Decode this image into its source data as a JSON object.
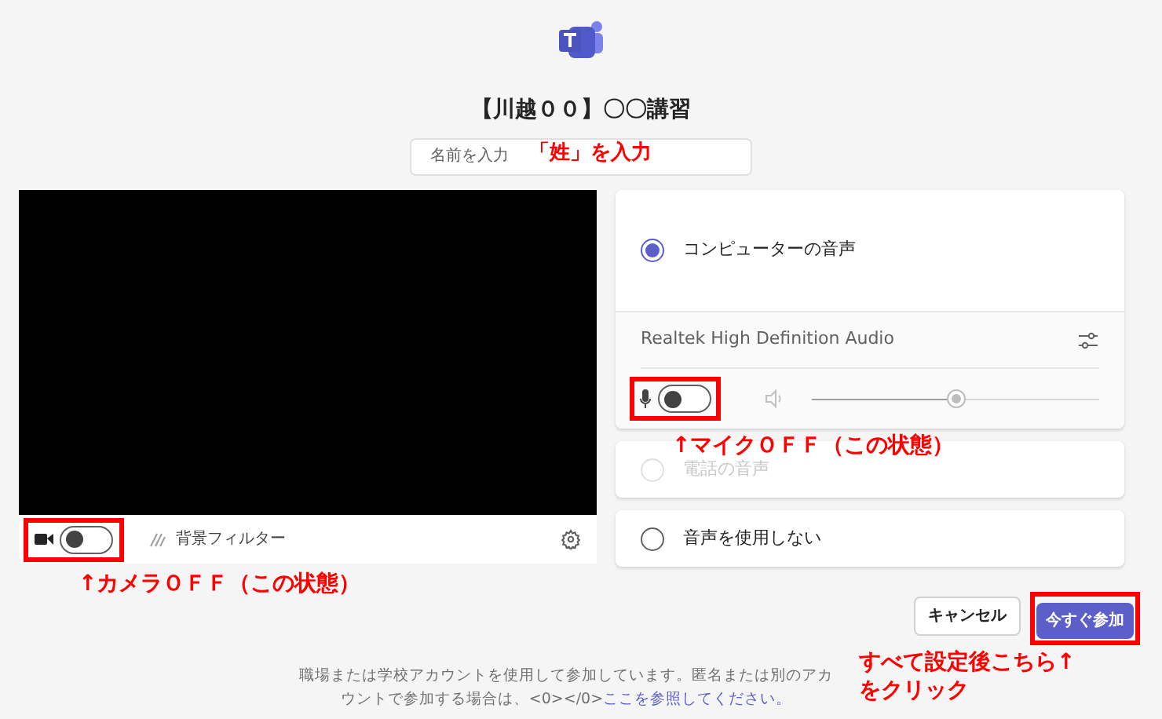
{
  "meeting_title": "【川越００】〇〇講習",
  "name_field": {
    "placeholder": "名前を入力",
    "annotation": "「姓」を入力"
  },
  "video": {
    "camera_on": false,
    "camera_annotation": "↑カメラＯＦＦ（この状態）",
    "background_filter": "背景フィルター"
  },
  "audio_options": [
    {
      "kind": "computer",
      "label": "コンピューターの音声",
      "selected": true,
      "disabled": false,
      "device": "Realtek High Definition Audio",
      "mic_on": false,
      "level": 0.5,
      "mic_annotation": "↑マイクＯＦＦ（この状態）"
    },
    {
      "kind": "plain",
      "label": "電話の音声",
      "selected": false,
      "disabled": true
    },
    {
      "kind": "plain",
      "label": "音声を使用しない",
      "selected": false,
      "disabled": false
    }
  ],
  "buttons": {
    "cancel": "キャンセル",
    "join": "今すぐ参加",
    "join_annotation": [
      "すべて設定後こちら↑",
      "をクリック"
    ]
  },
  "footer": {
    "text": "職場または学校アカウントを使用して参加しています。匿名または別のアカウントで参加する場合は、<0></0>",
    "link": "ここを参照してください。"
  }
}
